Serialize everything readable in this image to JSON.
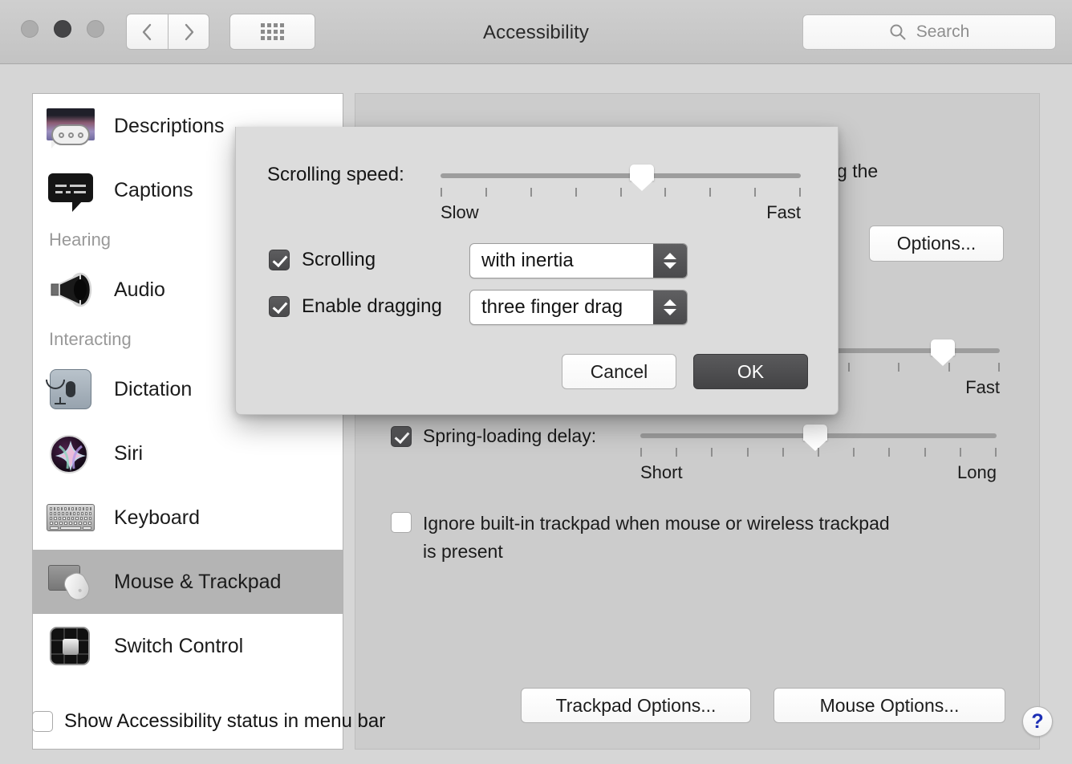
{
  "window": {
    "title": "Accessibility",
    "traffic_lights": [
      "close",
      "minimize",
      "maximize"
    ],
    "nav_back": "back-chevron",
    "nav_forward": "forward-chevron",
    "show_all": "grid-icon",
    "search": {
      "placeholder": "Search",
      "icon": "search-icon",
      "value": ""
    }
  },
  "sidebar": {
    "items": [
      {
        "type": "item",
        "label": "Descriptions",
        "icon": "descriptions-icon"
      },
      {
        "type": "item",
        "label": "Captions",
        "icon": "captions-icon"
      },
      {
        "type": "header",
        "label": "Hearing"
      },
      {
        "type": "item",
        "label": "Audio",
        "icon": "audio-speaker-icon"
      },
      {
        "type": "header",
        "label": "Interacting"
      },
      {
        "type": "item",
        "label": "Dictation",
        "icon": "microphone-icon"
      },
      {
        "type": "item",
        "label": "Siri",
        "icon": "siri-icon"
      },
      {
        "type": "item",
        "label": "Keyboard",
        "icon": "keyboard-icon"
      },
      {
        "type": "item",
        "label": "Mouse & Trackpad",
        "icon": "mouse-trackpad-icon",
        "selected": true
      },
      {
        "type": "item",
        "label": "Switch Control",
        "icon": "switch-control-icon"
      }
    ]
  },
  "main": {
    "occluded_text": "ntrolled using the",
    "options_button": "Options...",
    "double_click_slider": {
      "right_label": "Fast",
      "ticks": 5,
      "value_pct": 72
    },
    "spring_loading": {
      "checked": true,
      "label": "Spring-loading delay:",
      "left_label": "Short",
      "right_label": "Long",
      "ticks": 11,
      "value_pct": 49
    },
    "ignore_trackpad": {
      "checked": false,
      "line1": "Ignore built-in trackpad when mouse or wireless trackpad",
      "line2": "is present"
    },
    "trackpad_options_button": "Trackpad Options...",
    "mouse_options_button": "Mouse Options..."
  },
  "dialog": {
    "scrolling_speed": {
      "label": "Scrolling speed:",
      "left_label": "Slow",
      "right_label": "Fast",
      "ticks": 9,
      "value_pct": 56
    },
    "scrolling": {
      "checked": true,
      "label": "Scrolling",
      "value": "with inertia"
    },
    "enable_dragging": {
      "checked": true,
      "label": "Enable dragging",
      "value": "three finger drag"
    },
    "cancel_button": "Cancel",
    "ok_button": "OK"
  },
  "footer": {
    "show_status": {
      "checked": false,
      "label": "Show Accessibility status in menu bar"
    },
    "help_button": "?"
  }
}
